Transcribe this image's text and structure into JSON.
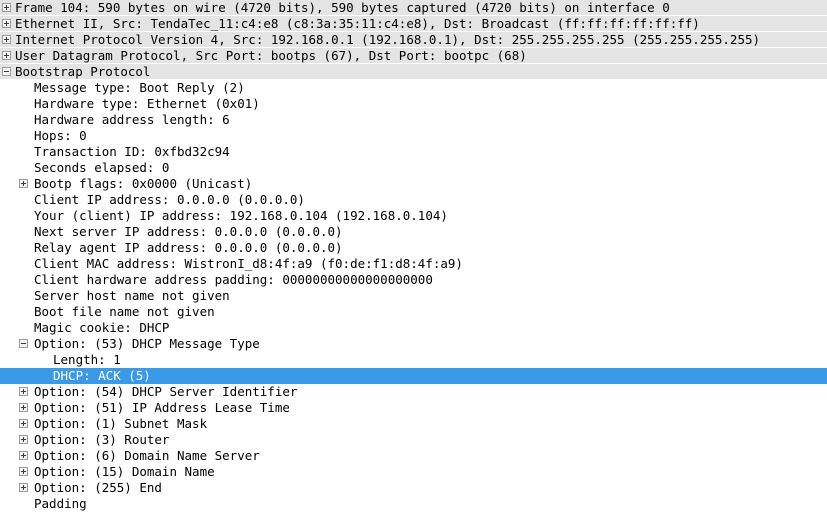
{
  "pane": {
    "name": "packet-details-tree",
    "selected_row_index": 21,
    "colors": {
      "selection_background": "#3a9ae8",
      "selection_text": "#ffffff",
      "protocol_row_background": "#e4e4e4",
      "body_background": "#ffffff",
      "text": "#000000"
    }
  },
  "rows": [
    {
      "depth": 0,
      "toggle": "plus",
      "text": "Frame 104: 590 bytes on wire (4720 bits), 590 bytes captured (4720 bits) on interface 0",
      "protocol": true,
      "selected": false
    },
    {
      "depth": 0,
      "toggle": "plus",
      "text": "Ethernet II, Src: TendaTec_11:c4:e8 (c8:3a:35:11:c4:e8), Dst: Broadcast (ff:ff:ff:ff:ff:ff)",
      "protocol": true,
      "selected": false
    },
    {
      "depth": 0,
      "toggle": "plus",
      "text": "Internet Protocol Version 4, Src: 192.168.0.1 (192.168.0.1), Dst: 255.255.255.255 (255.255.255.255)",
      "protocol": true,
      "selected": false
    },
    {
      "depth": 0,
      "toggle": "plus",
      "text": "User Datagram Protocol, Src Port: bootps (67), Dst Port: bootpc (68)",
      "protocol": true,
      "selected": false
    },
    {
      "depth": 0,
      "toggle": "minus",
      "text": "Bootstrap Protocol",
      "protocol": true,
      "selected": false
    },
    {
      "depth": 1,
      "toggle": "none",
      "text": "Message type: Boot Reply (2)",
      "protocol": false,
      "selected": false
    },
    {
      "depth": 1,
      "toggle": "none",
      "text": "Hardware type: Ethernet (0x01)",
      "protocol": false,
      "selected": false
    },
    {
      "depth": 1,
      "toggle": "none",
      "text": "Hardware address length: 6",
      "protocol": false,
      "selected": false
    },
    {
      "depth": 1,
      "toggle": "none",
      "text": "Hops: 0",
      "protocol": false,
      "selected": false
    },
    {
      "depth": 1,
      "toggle": "none",
      "text": "Transaction ID: 0xfbd32c94",
      "protocol": false,
      "selected": false
    },
    {
      "depth": 1,
      "toggle": "none",
      "text": "Seconds elapsed: 0",
      "protocol": false,
      "selected": false
    },
    {
      "depth": 1,
      "toggle": "plus",
      "text": "Bootp flags: 0x0000 (Unicast)",
      "protocol": false,
      "selected": false
    },
    {
      "depth": 1,
      "toggle": "none",
      "text": "Client IP address: 0.0.0.0 (0.0.0.0)",
      "protocol": false,
      "selected": false
    },
    {
      "depth": 1,
      "toggle": "none",
      "text": "Your (client) IP address: 192.168.0.104 (192.168.0.104)",
      "protocol": false,
      "selected": false
    },
    {
      "depth": 1,
      "toggle": "none",
      "text": "Next server IP address: 0.0.0.0 (0.0.0.0)",
      "protocol": false,
      "selected": false
    },
    {
      "depth": 1,
      "toggle": "none",
      "text": "Relay agent IP address: 0.0.0.0 (0.0.0.0)",
      "protocol": false,
      "selected": false
    },
    {
      "depth": 1,
      "toggle": "none",
      "text": "Client MAC address: WistronI_d8:4f:a9 (f0:de:f1:d8:4f:a9)",
      "protocol": false,
      "selected": false
    },
    {
      "depth": 1,
      "toggle": "none",
      "text": "Client hardware address padding: 00000000000000000000",
      "protocol": false,
      "selected": false
    },
    {
      "depth": 1,
      "toggle": "none",
      "text": "Server host name not given",
      "protocol": false,
      "selected": false
    },
    {
      "depth": 1,
      "toggle": "none",
      "text": "Boot file name not given",
      "protocol": false,
      "selected": false
    },
    {
      "depth": 1,
      "toggle": "none",
      "text": "Magic cookie: DHCP",
      "protocol": false,
      "selected": false
    },
    {
      "depth": 1,
      "toggle": "minus",
      "text": "Option: (53) DHCP Message Type",
      "protocol": false,
      "selected": false
    },
    {
      "depth": 2,
      "toggle": "none",
      "text": "Length: 1",
      "protocol": false,
      "selected": false
    },
    {
      "depth": 2,
      "toggle": "none",
      "text": "DHCP: ACK (5)",
      "protocol": false,
      "selected": true
    },
    {
      "depth": 1,
      "toggle": "plus",
      "text": "Option: (54) DHCP Server Identifier",
      "protocol": false,
      "selected": false
    },
    {
      "depth": 1,
      "toggle": "plus",
      "text": "Option: (51) IP Address Lease Time",
      "protocol": false,
      "selected": false
    },
    {
      "depth": 1,
      "toggle": "plus",
      "text": "Option: (1) Subnet Mask",
      "protocol": false,
      "selected": false
    },
    {
      "depth": 1,
      "toggle": "plus",
      "text": "Option: (3) Router",
      "protocol": false,
      "selected": false
    },
    {
      "depth": 1,
      "toggle": "plus",
      "text": "Option: (6) Domain Name Server",
      "protocol": false,
      "selected": false
    },
    {
      "depth": 1,
      "toggle": "plus",
      "text": "Option: (15) Domain Name",
      "protocol": false,
      "selected": false
    },
    {
      "depth": 1,
      "toggle": "plus",
      "text": "Option: (255) End",
      "protocol": false,
      "selected": false
    },
    {
      "depth": 1,
      "toggle": "none",
      "text": "Padding",
      "protocol": false,
      "selected": false
    }
  ]
}
